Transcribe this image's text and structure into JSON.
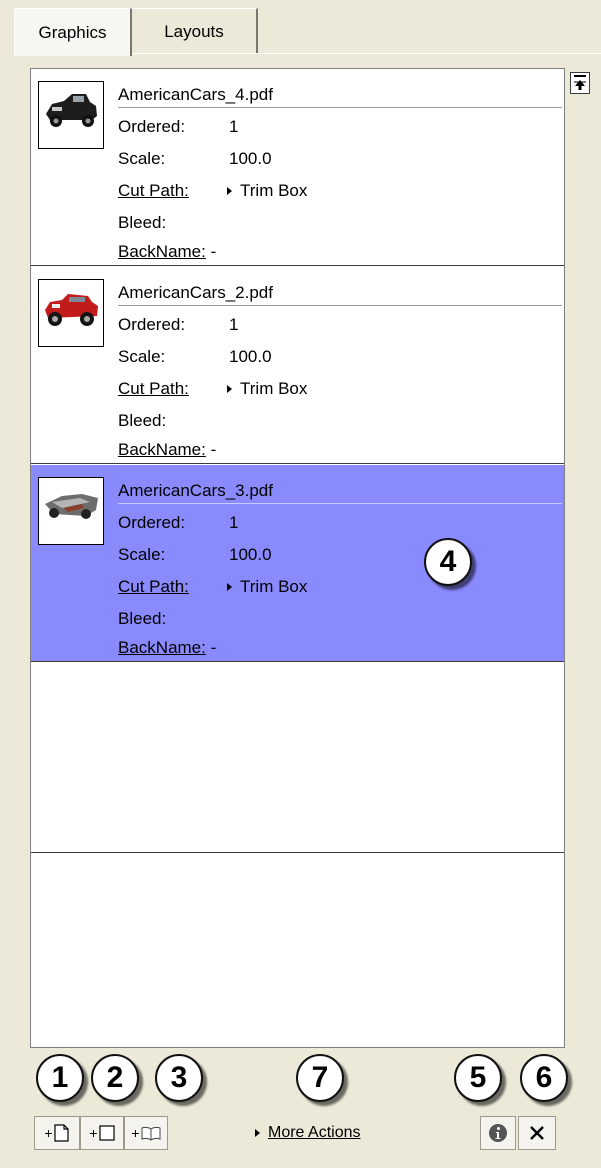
{
  "tabs": [
    {
      "label": "Graphics",
      "active": true
    },
    {
      "label": "Layouts",
      "active": false
    }
  ],
  "items": [
    {
      "filename": "AmericanCars_4.pdf",
      "ordered_label": "Ordered:",
      "ordered": "1",
      "scale_label": "Scale:",
      "scale": "100.0",
      "cutpath_label": "Cut Path:",
      "cutpath": "Trim Box",
      "bleed_label": "Bleed:",
      "bleed": "",
      "backname_label": "BackName:",
      "backname": "-",
      "thumb_icon": "black-truck-thumbnail",
      "selected": false
    },
    {
      "filename": "AmericanCars_2.pdf",
      "ordered_label": "Ordered:",
      "ordered": "1",
      "scale_label": "Scale:",
      "scale": "100.0",
      "cutpath_label": "Cut Path:",
      "cutpath": "Trim Box",
      "bleed_label": "Bleed:",
      "bleed": "",
      "backname_label": "BackName:",
      "backname": "-",
      "thumb_icon": "red-jeep-thumbnail",
      "selected": false
    },
    {
      "filename": "AmericanCars_3.pdf",
      "ordered_label": "Ordered:",
      "ordered": "1",
      "scale_label": "Scale:",
      "scale": "100.0",
      "cutpath_label": "Cut Path:",
      "cutpath": "Trim Box",
      "bleed_label": "Bleed:",
      "bleed": "",
      "backname_label": "BackName:",
      "backname": "-",
      "thumb_icon": "gray-car-thumbnail",
      "selected": true
    }
  ],
  "callouts": [
    "1",
    "2",
    "3",
    "4",
    "5",
    "6",
    "7"
  ],
  "toolbar": {
    "add_graphic_plus": "+",
    "add_blank_plus": "+",
    "add_folder_plus": "+",
    "more_actions": "More Actions",
    "info_icon": "info-icon",
    "delete_icon": "close-icon"
  },
  "colors": {
    "selection": "#8a8aff",
    "window_bg": "#ece9d8"
  }
}
